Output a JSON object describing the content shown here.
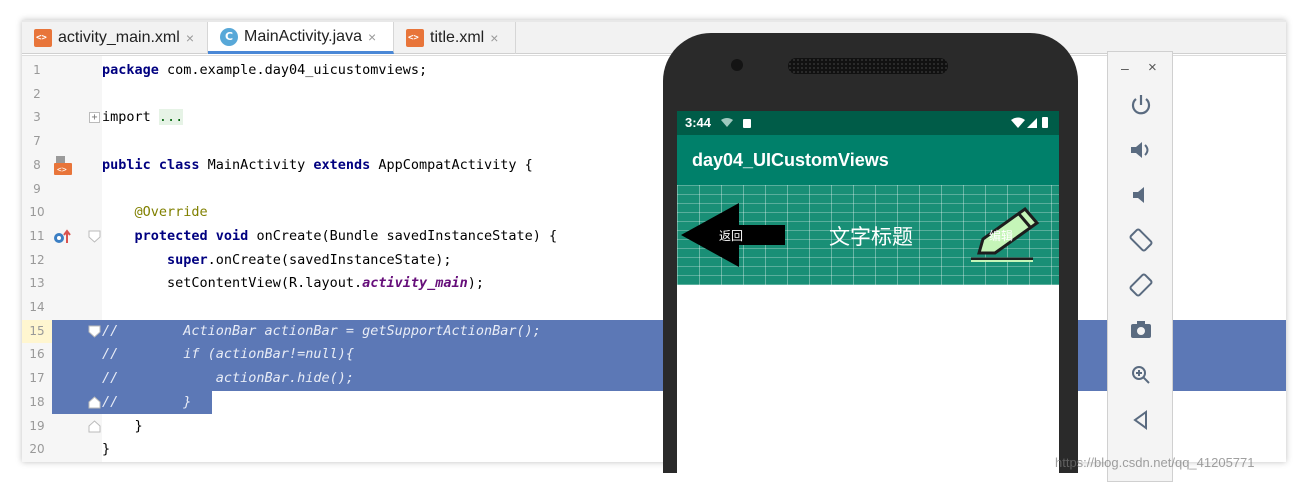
{
  "tabs": [
    {
      "label": "activity_main.xml",
      "icon": "xml-file-icon",
      "close": "×"
    },
    {
      "label": "MainActivity.java",
      "icon": "java-class-icon",
      "close": "×",
      "active": true,
      "icon_letter": "C"
    },
    {
      "label": "title.xml",
      "icon": "xml-file-icon",
      "close": "×"
    }
  ],
  "code_lines": [
    {
      "n": "1"
    },
    {
      "n": "2"
    },
    {
      "n": "3"
    },
    {
      "n": "7"
    },
    {
      "n": "8"
    },
    {
      "n": "9"
    },
    {
      "n": "10"
    },
    {
      "n": "11"
    },
    {
      "n": "12"
    },
    {
      "n": "13"
    },
    {
      "n": "14"
    },
    {
      "n": "15"
    },
    {
      "n": "16"
    },
    {
      "n": "17"
    },
    {
      "n": "18"
    },
    {
      "n": "19"
    },
    {
      "n": "20"
    }
  ],
  "code": {
    "l1_kw": "package",
    "l1_rest": " com.example.day04_uicustomviews;",
    "l3_kw": "import",
    "l3_fold": "...",
    "l8_kw1": "public class",
    "l8_mid": " MainActivity ",
    "l8_kw2": "extends",
    "l8_rest": " AppCompatActivity {",
    "l10_ann": "@Override",
    "l11_kw": "protected void",
    "l11_rest": " onCreate(Bundle savedInstanceState) {",
    "l12_kw": "super",
    "l12_rest": ".onCreate(savedInstanceState);",
    "l13_pre": "setContentView(R.layout.",
    "l13_fld": "activity_main",
    "l13_post": ");",
    "l15": "//        ActionBar actionBar = getSupportActionBar();",
    "l16": "//        if (actionBar!=null){",
    "l17": "//            actionBar.hide();",
    "l18": "//        }",
    "l19": "    }",
    "l20": "}"
  },
  "phone": {
    "time": "3:44",
    "app_title": "day04_UICustomViews",
    "back_label": "返回",
    "title_text": "文字标题",
    "edit_label": "编辑"
  },
  "emulator": {
    "minimize": "–",
    "close": "×"
  },
  "watermark": "https://blog.csdn.net/qq_41205771",
  "colors": {
    "selection": "#5c78b6",
    "appbar": "#00806a",
    "statusbar": "#005c48",
    "titlebar": "#198f76"
  }
}
